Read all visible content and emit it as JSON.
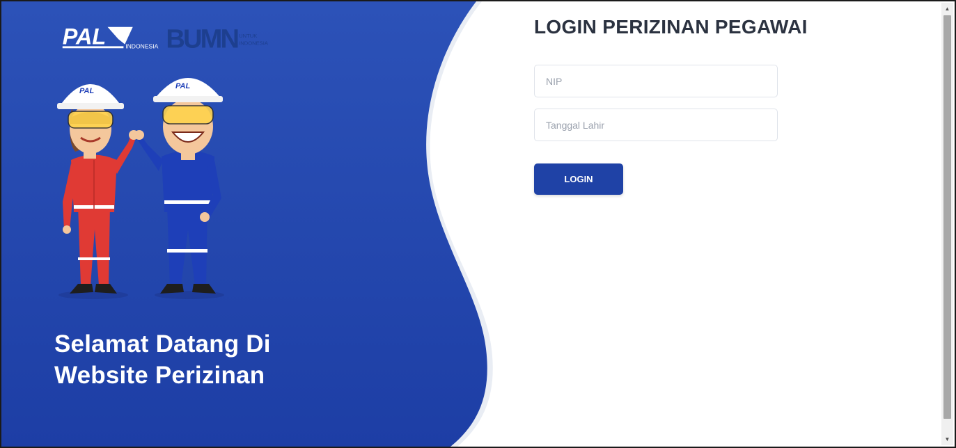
{
  "hero": {
    "brand_logo_text": "PAL",
    "brand_logo_sub": "INDONESIA",
    "bumn_logo_text": "BUMN",
    "bumn_logo_sub_1": "UNTUK",
    "bumn_logo_sub_2": "INDONESIA",
    "helmet_logo_text": "PAL",
    "welcome_line_1": "Selamat Datang Di",
    "welcome_line_2": "Website Perizinan"
  },
  "login": {
    "title": "LOGIN PERIZINAN PEGAWAI",
    "nip_placeholder": "NIP",
    "nip_value": "",
    "dob_placeholder": "Tanggal Lahir",
    "dob_value": "",
    "button_label": "LOGIN"
  },
  "icons": {
    "scroll_up": "scroll-up-arrow-icon",
    "scroll_down": "scroll-down-arrow-icon"
  },
  "colors": {
    "hero_blue_top": "#2c52b8",
    "hero_blue_bottom": "#1d3ea5",
    "button_blue": "#1f42a6",
    "title_text": "#2b3240",
    "welcome_text": "#ffffff",
    "coverall_red": "#e03a34",
    "coverall_blue": "#1e3fb8",
    "bumn_teal": "#1aa6b7",
    "bumn_navy": "#1d3f8f"
  }
}
